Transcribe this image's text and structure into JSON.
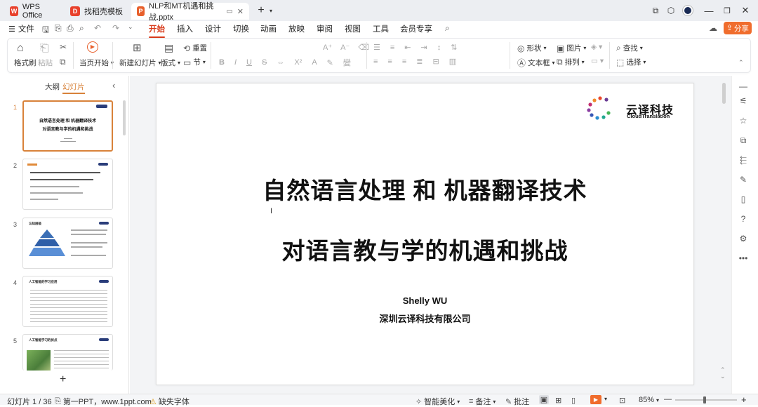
{
  "tabs": [
    {
      "label": "WPS Office",
      "logo": "W",
      "color": "#e8412c"
    },
    {
      "label": "找稻壳模板",
      "logo": "D",
      "color": "#e8412c"
    },
    {
      "label": "NLP和MT机遇和挑战.pptx",
      "logo": "P",
      "color": "#e8602c"
    }
  ],
  "menu": {
    "file": "文件",
    "items": [
      "开始",
      "插入",
      "设计",
      "切换",
      "动画",
      "放映",
      "审阅",
      "视图",
      "工具",
      "会员专享"
    ],
    "share": "分享"
  },
  "ribbon": {
    "format_painter": "格式刷",
    "paste": "粘贴",
    "play_from_current": "当页开始",
    "new_slide": "新建幻灯片",
    "layout": "版式",
    "section": "节",
    "reset": "重置",
    "shape": "形状",
    "picture": "图片",
    "find": "查找",
    "textbox": "文本框",
    "arrange": "排列",
    "select": "选择"
  },
  "panel": {
    "outline_tab": "大纲",
    "slides_tab": "幻灯片",
    "numbers": [
      "1",
      "2",
      "3",
      "4",
      "5"
    ]
  },
  "slide": {
    "logo_cn": "云译科技",
    "logo_en": "CloudTranslation",
    "title_line1": "自然语言处理 和 机器翻译技术",
    "title_line2": "对语言教与学的机遇和挑战",
    "author": "Shelly WU",
    "company": "深圳云译科技有限公司"
  },
  "thumbs": {
    "t1_line1": "自然语言处理 和 机器翻译技术",
    "t1_line2": "对语言教与学的机遇和挑战",
    "t3_title": "认知层级",
    "t4_title": "人工智能的学习应用",
    "t5_title": "人工智能学习的优点"
  },
  "status": {
    "slide_count": "幻灯片 1 / 36",
    "theme": "第一PPT，www.1ppt.com",
    "missing_font": "缺失字体",
    "smart": "智能美化",
    "notes": "备注",
    "comments": "批注",
    "zoom": "85%"
  },
  "colors": {
    "accent": "#d83a1a",
    "share_bg": "#f06d2d",
    "selected_thumb": "#d8823a"
  }
}
